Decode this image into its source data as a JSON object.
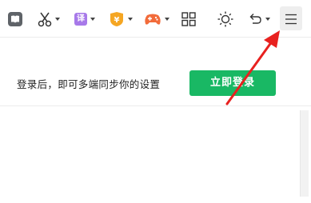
{
  "toolbar": {
    "items": [
      {
        "name": "reader-icon"
      },
      {
        "name": "scissors-icon"
      },
      {
        "name": "translate-icon",
        "glyph": "译"
      },
      {
        "name": "coupon-shield-icon",
        "glyph": "¥"
      },
      {
        "name": "game-controller-icon"
      },
      {
        "name": "apps-grid-icon"
      },
      {
        "name": "brightness-icon"
      },
      {
        "name": "undo-icon"
      },
      {
        "name": "menu-icon"
      }
    ]
  },
  "login": {
    "prompt": "登录后，即可多端同步你的设置",
    "button_label": "立即登录"
  },
  "colors": {
    "login_green": "#19b864",
    "annotation_red": "#e8211f",
    "translate_purple": "#a779e9",
    "coupon_orange": "#f5a623",
    "game_orange": "#f26b3a"
  }
}
